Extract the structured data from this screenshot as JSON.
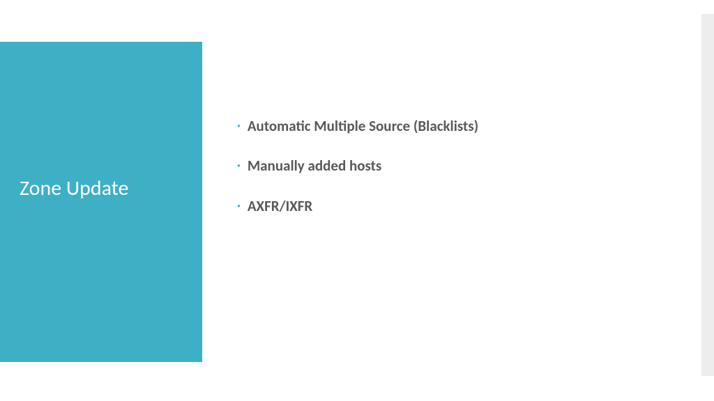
{
  "title": "Zone Update",
  "bullets": [
    "Automatic Multiple Source (Blacklists)",
    "Manually added hosts",
    "AXFR/IXFR"
  ],
  "colors": {
    "accent": "#3db0c6",
    "text": "#595959"
  }
}
